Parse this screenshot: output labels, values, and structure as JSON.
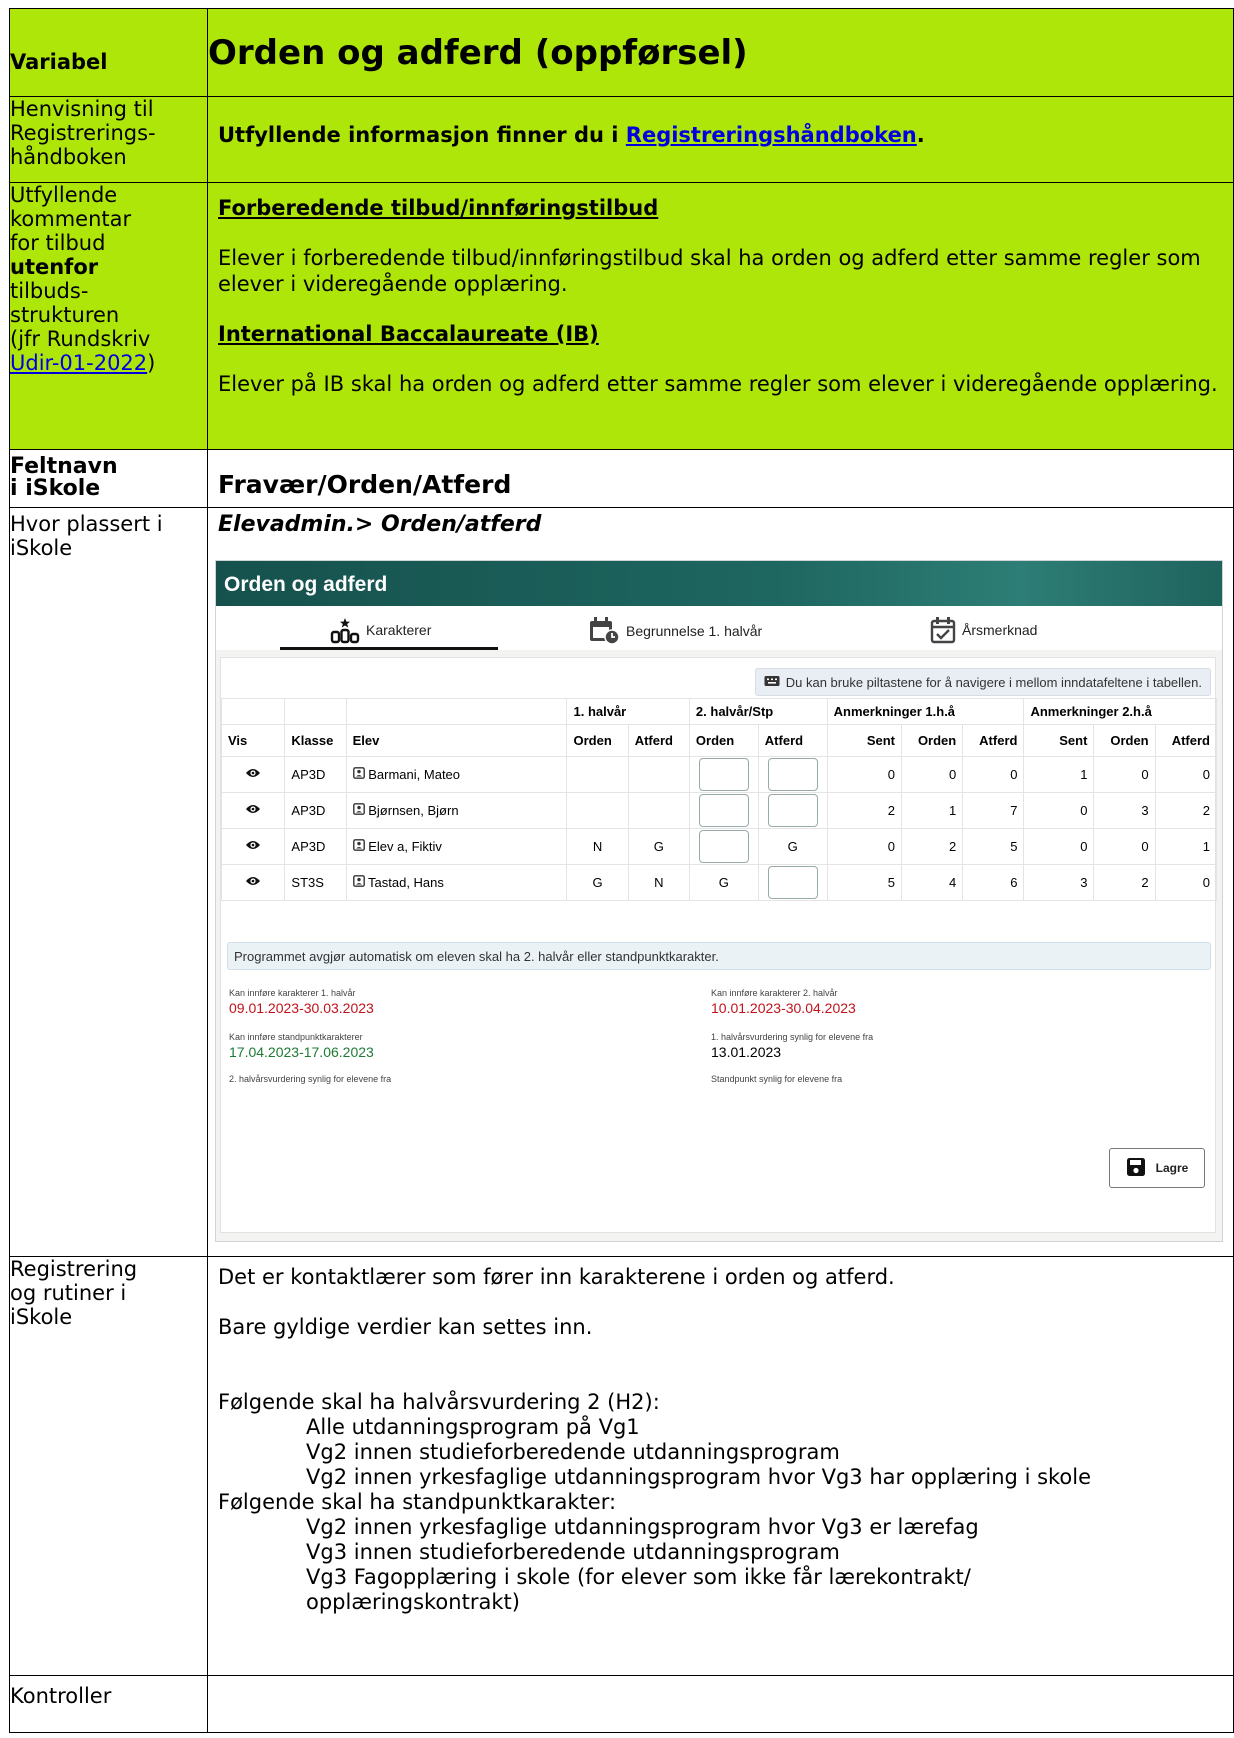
{
  "row1": {
    "label": "Variabel",
    "title": "Orden og adferd (oppførsel)"
  },
  "row2": {
    "label_lines": [
      "Henvisning til",
      "Registrerings-",
      "håndboken"
    ],
    "text_before": "Utfyllende informasjon finner du i ",
    "link": "Registreringshåndboken",
    "text_after": "."
  },
  "row3": {
    "label_lines": [
      "Utfyllende",
      "kommentar",
      "for tilbud"
    ],
    "label_bold": "utenfor",
    "label_lines2": [
      "tilbuds-",
      "strukturen",
      "(jfr Rundskriv"
    ],
    "label_link": "Udir-01-2022",
    "label_tail": ")",
    "h1": "Forberedende tilbud/innføringstilbud",
    "p1": "Elever i forberedende tilbud/innføringstilbud skal ha orden og adferd etter samme regler som elever i videregående opplæring.",
    "h2": "International Baccalaureate (IB)",
    "p2": "Elever på IB skal ha orden og adferd etter samme regler som elever i videregående opplæring."
  },
  "row4": {
    "label_lines": [
      "Feltnavn",
      "i iSkole"
    ],
    "value": "Fravær/Orden/Atferd"
  },
  "row5": {
    "label_lines": [
      "Hvor plassert i",
      "iSkole"
    ],
    "path": "Elevadmin.> Orden/atferd",
    "screenshot": {
      "title": "Orden og adferd",
      "tabs": [
        "Karakterer",
        "Begrunnelse 1. halvår",
        "Årsmerknad"
      ],
      "hint": "Du kan bruke piltastene for å navigere i mellom inndatafeltene i tabellen.",
      "group_headers": [
        "1. halvår",
        "2. halvår/Stp",
        "Anmerkninger 1.h.å",
        "Anmerkninger 2.h.å"
      ],
      "col_headers": [
        "Vis",
        "Klasse",
        "Elev",
        "Orden",
        "Atferd",
        "Orden",
        "Atferd",
        "Sent",
        "Orden",
        "Atferd",
        "Sent",
        "Orden",
        "Atferd"
      ],
      "rows": [
        {
          "klasse": "AP3D",
          "elev": "Barmani, Mateo",
          "h1o": "",
          "h1a": "",
          "h2o": "",
          "h2a": "",
          "a1s": "0",
          "a1o": "0",
          "a1a": "0",
          "a2s": "1",
          "a2o": "0",
          "a2a": "0"
        },
        {
          "klasse": "AP3D",
          "elev": "Bjørnsen, Bjørn",
          "h1o": "",
          "h1a": "",
          "h2o": "",
          "h2a": "",
          "a1s": "2",
          "a1o": "1",
          "a1a": "7",
          "a2s": "0",
          "a2o": "3",
          "a2a": "2"
        },
        {
          "klasse": "AP3D",
          "elev": "Elev a, Fiktiv",
          "h1o": "N",
          "h1a": "G",
          "h2o": "",
          "h2a": "G",
          "a1s": "0",
          "a1o": "2",
          "a1a": "5",
          "a2s": "0",
          "a2o": "0",
          "a2a": "1"
        },
        {
          "klasse": "ST3S",
          "elev": "Tastad, Hans",
          "h1o": "G",
          "h1a": "N",
          "h2o": "G",
          "h2a": "",
          "a1s": "5",
          "a1o": "4",
          "a1a": "6",
          "a2s": "3",
          "a2o": "2",
          "a2a": "0"
        }
      ],
      "info": "Programmet avgjør automatisk om eleven skal ha 2. halvår eller standpunktkarakter.",
      "meta": {
        "l1": "Kan innføre karakterer 1. halvår",
        "v1": "09.01.2023-30.03.2023",
        "l2": "Kan innføre karakterer 2. halvår",
        "v2": "10.01.2023-30.04.2023",
        "l3": "Kan innføre standpunktkarakterer",
        "v3": "17.04.2023-17.06.2023",
        "l4": "1. halvårsvurdering synlig for elevene fra",
        "v4": "13.01.2023",
        "l5": "2. halvårsvurdering synlig for elevene fra",
        "l6": "Standpunkt synlig for elevene fra"
      },
      "save": "Lagre",
      "colors": {
        "header": "#1e6660",
        "red_date": "#c0131c",
        "green_date": "#1f7a35"
      }
    }
  },
  "row6": {
    "label_lines": [
      "Registrering",
      "og rutiner i",
      "iSkole"
    ],
    "p1": "Det er kontaktlærer som fører inn karakterene i orden og atferd.",
    "p2": "Bare gyldige verdier kan settes inn.",
    "h2_head": "Følgende skal ha halvårsvurdering 2 (H2):",
    "h2_items": [
      "Alle utdanningsprogram på Vg1",
      "Vg2 innen studieforberedende utdanningsprogram",
      "Vg2 innen yrkesfaglige utdanningsprogram hvor Vg3 har opplæring i skole"
    ],
    "stp_head": "Følgende skal ha standpunktkarakter:",
    "stp_items": [
      "Vg2 innen yrkesfaglige utdanningsprogram hvor Vg3 er lærefag",
      "Vg3 innen studieforberedende utdanningsprogram",
      "Vg3 Fagopplæring i skole (for elever som ikke får lærekontrakt/",
      "opplæringskontrakt)"
    ]
  },
  "row7": {
    "label": "Kontroller"
  },
  "colors": {
    "green": "#aee60a",
    "link": "#0000e0"
  }
}
